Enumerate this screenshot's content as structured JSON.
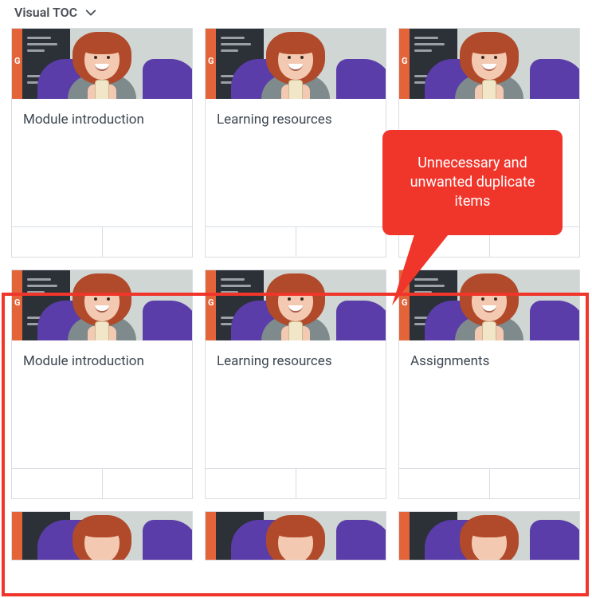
{
  "header": {
    "title": "Visual TOC"
  },
  "cards_row1": [
    {
      "title": "Module introduction"
    },
    {
      "title": "Learning resources"
    },
    {
      "title": ""
    }
  ],
  "cards_row2": [
    {
      "title": "Module introduction"
    },
    {
      "title": "Learning resources"
    },
    {
      "title": "Assignments"
    }
  ],
  "annotation": {
    "text": "Unnecessary and unwanted duplicate items"
  }
}
